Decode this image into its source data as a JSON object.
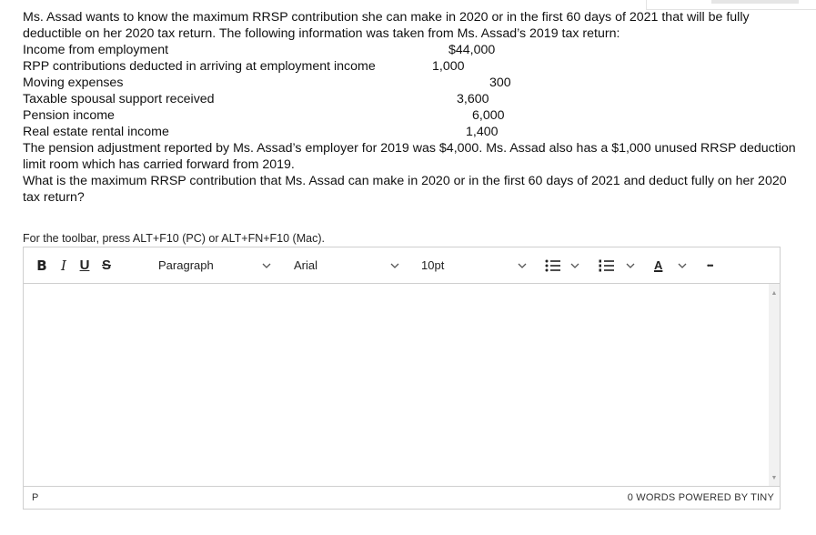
{
  "question": {
    "intro": "Ms. Assad wants to know the maximum RRSP contribution she can make in 2020 or in the first 60 days of 2021 that will be fully deductible on her 2020 tax return. The following information was taken from Ms. Assad’s 2019 tax return:",
    "items": [
      {
        "label": "Income from employment",
        "value": "$44,000"
      },
      {
        "label": "RPP contributions deducted in arriving at employment income",
        "value": "1,000"
      },
      {
        "label": "Moving expenses",
        "value": "300"
      },
      {
        "label": "Taxable spousal support received",
        "value": "3,600"
      },
      {
        "label": "Pension income",
        "value": "6,000"
      },
      {
        "label": "Real estate rental income",
        "value": "1,400"
      }
    ],
    "paragraph2": "The pension adjustment reported by Ms. Assad’s employer for 2019 was $4,000. Ms. Assad also has a $1,000 unused RRSP deduction limit room which has carried forward from 2019.",
    "paragraph3": "What is the maximum RRSP contribution that Ms. Assad can make in 2020 or in the first 60 days of 2021 and deduct fully on her 2020 tax return?"
  },
  "editor": {
    "hint": "For the toolbar, press ALT+F10 (PC) or ALT+FN+F10 (Mac).",
    "toolbar": {
      "bold": "B",
      "italic": "I",
      "underline": "U",
      "strike": "S",
      "block_format": "Paragraph",
      "font_family": "Arial",
      "font_size": "10pt",
      "text_color": "A",
      "more": "•••"
    },
    "status": {
      "path": "P",
      "wordcount": "0 WORDS",
      "powered": "POWERED BY TINY"
    }
  }
}
